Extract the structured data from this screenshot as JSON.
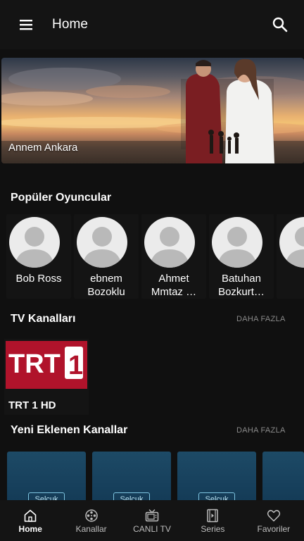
{
  "appbar": {
    "title": "Home"
  },
  "hero": {
    "title": "Annem Ankara"
  },
  "popular_actors": {
    "title": "Popüler Oyuncular",
    "items": [
      {
        "line1": "Bob Ross",
        "line2": ""
      },
      {
        "line1": "ebnem",
        "line2": "Bozoklu"
      },
      {
        "line1": "Ahmet",
        "line2": "Mmtaz …"
      },
      {
        "line1": "Batuhan",
        "line2": "Bozkurt…"
      },
      {
        "line1": "",
        "line2": ""
      }
    ]
  },
  "tv_channels": {
    "title": "TV Kanalları",
    "more": "DAHA FAZLA",
    "items": [
      {
        "name": "TRT 1 HD",
        "logo_text": "TRT",
        "logo_number": "1"
      }
    ]
  },
  "new_channels": {
    "title": "Yeni Eklenen Kanallar",
    "more": "DAHA FAZLA",
    "items": [
      {
        "tag": "Selçuk"
      },
      {
        "tag": "Selçuk"
      },
      {
        "tag": "Selçuk"
      },
      {
        "tag": ""
      }
    ]
  },
  "bottom_nav": {
    "items": [
      {
        "label": "Home",
        "icon": "home-icon",
        "active": true
      },
      {
        "label": "Kanallar",
        "icon": "film-reel-icon",
        "active": false
      },
      {
        "label": "CANLI TV",
        "icon": "tv-icon",
        "active": false
      },
      {
        "label": "Series",
        "icon": "film-strip-icon",
        "active": false
      },
      {
        "label": "Favoriler",
        "icon": "heart-icon",
        "active": false
      }
    ]
  },
  "colors": {
    "background": "#101010",
    "bar": "#141414",
    "accent_red": "#b0132b",
    "muted": "#8a8a8a"
  }
}
